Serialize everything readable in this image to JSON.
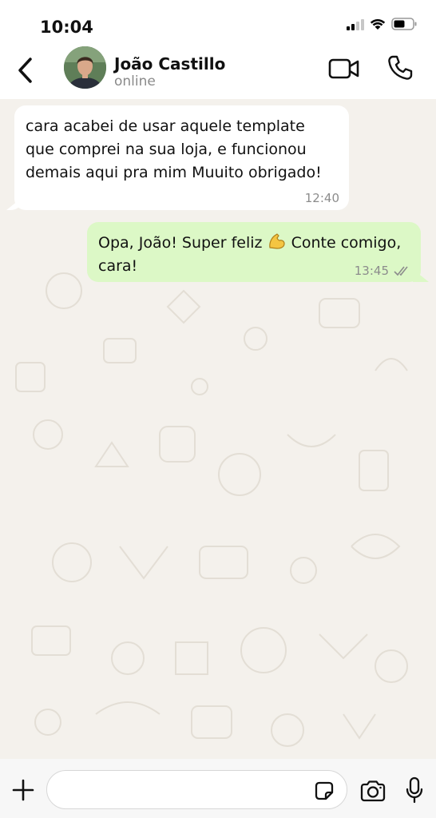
{
  "status_bar": {
    "time": "10:04",
    "icons": [
      "signal-icon",
      "wifi-icon",
      "battery-icon"
    ]
  },
  "header": {
    "contact_name": "João Castillo",
    "contact_status": "online",
    "icons": [
      "back-arrow-icon",
      "video-call-icon",
      "phone-icon"
    ]
  },
  "messages": [
    {
      "direction": "incoming",
      "text": "cara acabei de usar aquele template que comprei na sua loja, e funcionou demais aqui pra mim Muuito obrigado!",
      "time": "12:40"
    },
    {
      "direction": "outgoing",
      "text_before_emoji": "Opa, João! Super feliz ",
      "emoji": "flexed-biceps-emoji",
      "text_after_emoji": " Conte comigo, cara!",
      "time": "13:45",
      "status": "read-double-check-icon"
    }
  ],
  "composer": {
    "placeholder": "",
    "icons": [
      "plus-icon",
      "sticker-icon",
      "camera-icon",
      "microphone-icon"
    ]
  },
  "colors": {
    "outgoing_bubble": "#dcf8c6",
    "incoming_bubble": "#ffffff",
    "chat_background": "#f4f1ec",
    "read_ticks": "#8c8c8c"
  }
}
